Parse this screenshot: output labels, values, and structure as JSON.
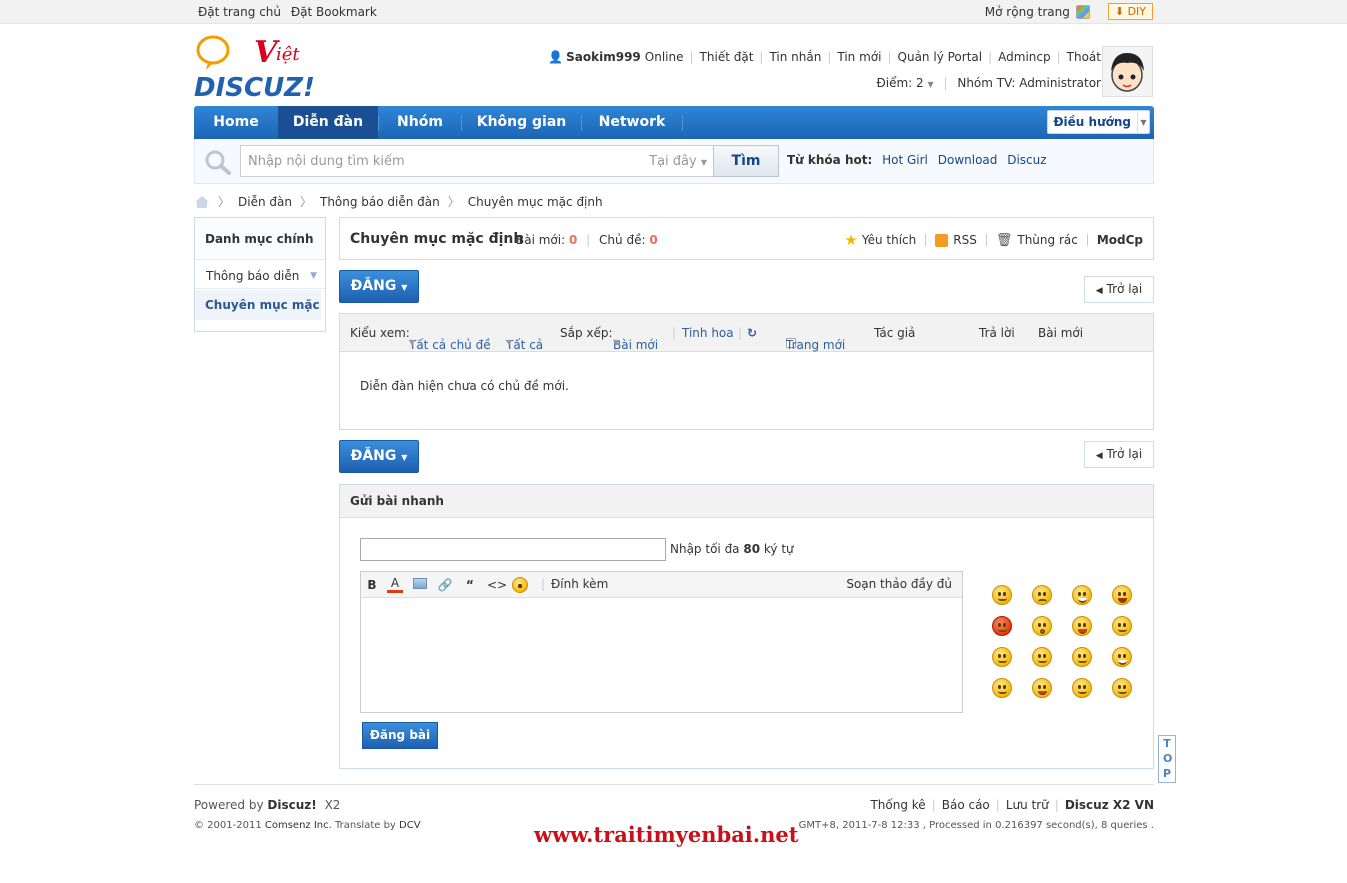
{
  "topbar": {
    "set_home": "Đặt trang chủ",
    "bookmark": "Đặt Bookmark",
    "expand": "Mở rộng trang",
    "diy": "DIY"
  },
  "header": {
    "username": "Saokim999",
    "online": "Online",
    "links": [
      "Thiết đặt",
      "Tin nhắn",
      "Tin mới",
      "Quản lý Portal",
      "Admincp",
      "Thoát"
    ],
    "points_label": "Điểm: 2",
    "group_label": "Nhóm TV: Administrator"
  },
  "nav": {
    "items": [
      "Home",
      "Diễn đàn",
      "Nhóm",
      "Không gian",
      "Network"
    ],
    "active": "Diễn đàn",
    "nav_menu": "Điều hướng"
  },
  "search": {
    "placeholder": "Nhập nội dung tìm kiếm",
    "scope": "Tại đây",
    "button": "Tìm",
    "hot_label": "Từ khóa hot:",
    "hot": [
      "Hot Girl",
      "Download",
      "Discuz"
    ]
  },
  "breadcrumb": [
    "Diễn đàn",
    "Thông báo diễn đàn",
    "Chuyên mục mặc định"
  ],
  "sidebar": {
    "heading": "Danh mục chính",
    "items": [
      "Thông báo diễn",
      "Chuyên mục mặc"
    ]
  },
  "forum": {
    "title": "Chuyên mục mặc định",
    "new_posts_label": "Bài mới:",
    "new_posts": "0",
    "topics_label": "Chủ đề:",
    "topics": "0",
    "actions": [
      "Yêu thích",
      "RSS",
      "Thùng rác",
      "ModCp"
    ],
    "post_button": "ĐĂNG",
    "back_button": "Trở lại"
  },
  "list": {
    "view_label": "Kiểu xem:",
    "view_all": "Tất cả chủ đề",
    "filter_all": "Tất cả",
    "sort_label": "Sắp xếp:",
    "sort_value": "Bài mới",
    "digest": "Tinh hoa",
    "new_window": "Trang mới",
    "col_author": "Tác giả",
    "col_replies": "Trả lời",
    "col_last": "Bài mới",
    "empty": "Diễn đàn hiện chưa có chủ đề mới."
  },
  "quick": {
    "heading": "Gửi bài nhanh",
    "hint_pre": "Nhập tối đa",
    "hint_num": "80",
    "hint_post": "ký tự",
    "attach": "Đính kèm",
    "full_editor": "Soạn thảo đầy đủ",
    "submit": "Đăng bài"
  },
  "top_button": "TOP",
  "footer": {
    "powered_pre": "Powered by",
    "powered_brand": "Discuz!",
    "powered_ver": "X2",
    "copyright_pre": "© 2001-2011",
    "copyright_company": "Comsenz Inc.",
    "copyright_tr": "Translate by",
    "copyright_dcv": "DCV",
    "links": [
      "Thống kê",
      "Báo cáo",
      "Lưu trữ"
    ],
    "brand": "Discuz X2 VN",
    "meta": "GMT+8, 2011-7-8 12:33 , Processed in 0.216397 second(s), 8 queries .",
    "watermark": "www.traitimyenbai.net"
  },
  "colors": {
    "nav_blue": "#1e64b4",
    "nav_active": "#1a4f93",
    "link_blue": "#14468c",
    "count_orange": "#f26c4f",
    "watermark_red": "#c8101a"
  }
}
